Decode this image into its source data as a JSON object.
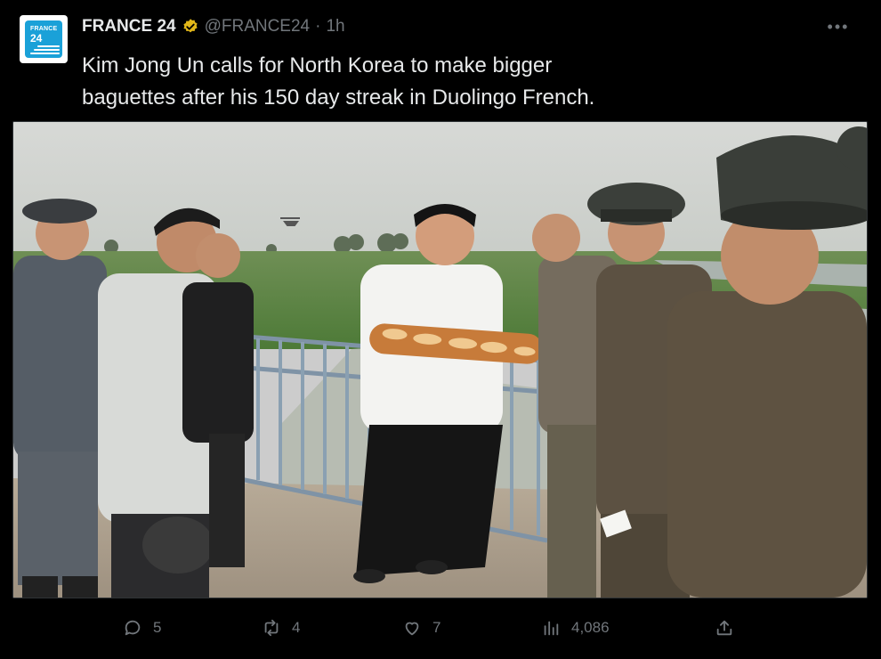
{
  "account": {
    "display_name": "FRANCE 24",
    "handle": "@FRANCE24",
    "separator": "·",
    "time": "1h",
    "verified": true,
    "avatar_text_top": "FRANCE",
    "avatar_text_bottom": "24"
  },
  "tweet": {
    "text_line1": "Kim Jong Un calls for North Korea to make bigger",
    "text_line2": "baguettes after his 150 day streak in Duolingo French."
  },
  "more_label": "•••",
  "actions": {
    "replies": "5",
    "reposts": "4",
    "likes": "7",
    "views": "4,086"
  },
  "colors": {
    "background": "#000000",
    "text": "#e7e9ea",
    "muted": "#71767b",
    "verified_gold": "#e2b719",
    "brand_blue": "#1aa1d8"
  },
  "icons": [
    "more-icon",
    "verified-icon",
    "reply-icon",
    "repost-icon",
    "like-icon",
    "views-icon",
    "share-icon"
  ]
}
